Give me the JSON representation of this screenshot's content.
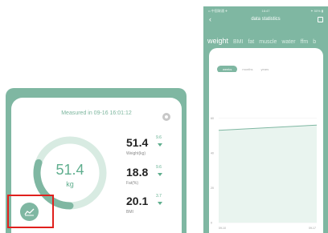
{
  "left": {
    "measured": "Measured in 09-16 16:01:12",
    "ring": {
      "value": "51.4",
      "unit": "kg",
      "fill_fraction": 0.3
    },
    "metrics": [
      {
        "value": "51.4",
        "label": "Weight(kg)",
        "delta": "9.6"
      },
      {
        "value": "18.8",
        "label": "Fat(%)",
        "delta": "9.6"
      },
      {
        "value": "20.1",
        "label": "BMI",
        "delta": "3.7"
      }
    ],
    "trend_icon": "trend-chart-icon"
  },
  "right": {
    "status": {
      "left": "•• 中国联通 ✈",
      "time": "16:47",
      "right": "✦ 50% ▮"
    },
    "nav": {
      "back": "‹",
      "title": "data statistics",
      "calendar_icon": "calendar-icon"
    },
    "tabs": [
      "weight",
      "BMI",
      "fat",
      "muscle",
      "water",
      "ffm",
      "b"
    ],
    "active_tab": 0,
    "periods": [
      "weeks",
      "months",
      "years"
    ],
    "active_period": 0,
    "chart_data": {
      "type": "area",
      "y_ticks": [
        "0",
        "20",
        "40",
        "60"
      ],
      "x": [
        "09-10",
        "09-17"
      ],
      "values": [
        53,
        56
      ],
      "ylim": [
        0,
        80
      ]
    }
  },
  "colors": {
    "brand": "#7fb7a2",
    "accent_text": "#5fae8e",
    "highlight": "#e0201d"
  }
}
